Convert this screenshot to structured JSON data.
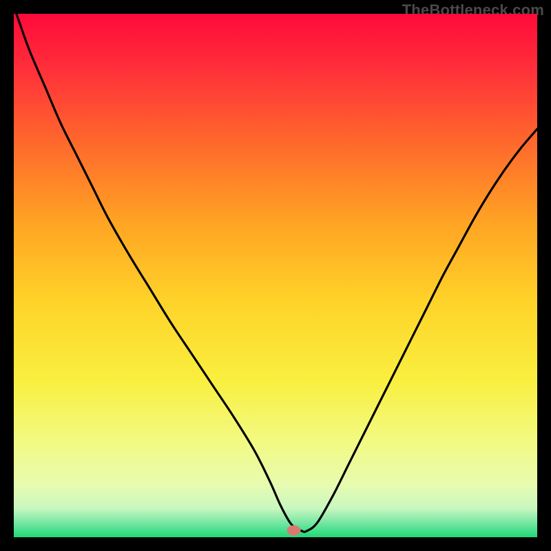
{
  "watermark": "TheBottleneck.com",
  "chart_data": {
    "type": "line",
    "title": "",
    "xlabel": "",
    "ylabel": "",
    "xlim": [
      0,
      100
    ],
    "ylim": [
      0,
      100
    ],
    "background_gradient": {
      "stops": [
        {
          "offset": 0.0,
          "color": "#ff0a3a"
        },
        {
          "offset": 0.1,
          "color": "#ff2d3a"
        },
        {
          "offset": 0.25,
          "color": "#ff6a2c"
        },
        {
          "offset": 0.4,
          "color": "#ffa423"
        },
        {
          "offset": 0.55,
          "color": "#ffd329"
        },
        {
          "offset": 0.7,
          "color": "#f9ef3f"
        },
        {
          "offset": 0.82,
          "color": "#f2fa84"
        },
        {
          "offset": 0.9,
          "color": "#e7fbb0"
        },
        {
          "offset": 0.945,
          "color": "#c9f7c0"
        },
        {
          "offset": 0.97,
          "color": "#7de8a6"
        },
        {
          "offset": 1.0,
          "color": "#1fd877"
        }
      ]
    },
    "marker": {
      "x": 53.5,
      "y": 1.3,
      "color": "#d97a6f"
    },
    "series": [
      {
        "name": "curve",
        "x": [
          0.5,
          3,
          6,
          9,
          12,
          15,
          18,
          22,
          26,
          30,
          34,
          38,
          42,
          46,
          49,
          51,
          53,
          55,
          56,
          58,
          61,
          64,
          67,
          70,
          73,
          76,
          79,
          82,
          85,
          88,
          91,
          94,
          97,
          100
        ],
        "y": [
          100,
          93,
          86,
          79,
          73,
          67,
          61,
          54,
          47.5,
          41,
          35,
          29,
          23,
          16.5,
          10.5,
          6,
          2.5,
          1.2,
          1.2,
          2.8,
          8,
          14,
          20,
          26,
          32,
          38,
          44,
          50,
          55.5,
          61,
          66,
          70.5,
          74.5,
          78
        ]
      }
    ]
  }
}
